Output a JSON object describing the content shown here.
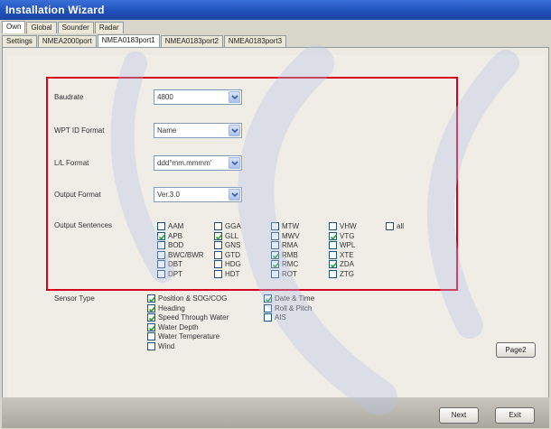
{
  "window": {
    "title": "Installation Wizard"
  },
  "tabs_top": [
    "Own",
    "Global",
    "Sounder",
    "Radar"
  ],
  "tabs_sub": [
    "Settings",
    "NMEA2000port",
    "NMEA0183port1",
    "NMEA0183port2",
    "NMEA0183port3"
  ],
  "active_sub_tab": "NMEA0183port1",
  "fields": {
    "baudrate": {
      "label": "Baudrate",
      "value": "4800"
    },
    "wpt_id": {
      "label": "WPT ID Format",
      "value": "Name"
    },
    "ll_format": {
      "label": "L/L Format",
      "value": "ddd°mm.mmmm'"
    },
    "output_format": {
      "label": "Output Format",
      "value": "Ver.3.0"
    }
  },
  "output_sentences_label": "Output Sentences",
  "output_sentences": [
    {
      "name": "AAM",
      "checked": false
    },
    {
      "name": "APB",
      "checked": true
    },
    {
      "name": "BOD",
      "checked": false
    },
    {
      "name": "BWC/BWR",
      "checked": false
    },
    {
      "name": "DBT",
      "checked": false
    },
    {
      "name": "DPT",
      "checked": false
    },
    {
      "name": "GGA",
      "checked": false
    },
    {
      "name": "GLL",
      "checked": true
    },
    {
      "name": "GNS",
      "checked": false
    },
    {
      "name": "GTD",
      "checked": false
    },
    {
      "name": "HDG",
      "checked": false
    },
    {
      "name": "HDT",
      "checked": false
    },
    {
      "name": "MTW",
      "checked": false
    },
    {
      "name": "MWV",
      "checked": false
    },
    {
      "name": "RMA",
      "checked": false
    },
    {
      "name": "RMB",
      "checked": true
    },
    {
      "name": "RMC",
      "checked": true
    },
    {
      "name": "ROT",
      "checked": false
    },
    {
      "name": "VHW",
      "checked": false
    },
    {
      "name": "VTG",
      "checked": true
    },
    {
      "name": "WPL",
      "checked": false
    },
    {
      "name": "XTE",
      "checked": false
    },
    {
      "name": "ZDA",
      "checked": true
    },
    {
      "name": "ZTG",
      "checked": false
    },
    {
      "name": "all",
      "checked": false
    }
  ],
  "sensor_type_label": "Sensor Type",
  "sensor_types": [
    {
      "name": "Position & SOG/COG",
      "checked": true
    },
    {
      "name": "Heading",
      "checked": true
    },
    {
      "name": "Speed Through Water",
      "checked": true
    },
    {
      "name": "Water Depth",
      "checked": true
    },
    {
      "name": "Water Temperature",
      "checked": false
    },
    {
      "name": "Wind",
      "checked": false
    },
    {
      "name": "Date & Time",
      "checked": true
    },
    {
      "name": "Roll & Pitch",
      "checked": false
    },
    {
      "name": "AIS",
      "checked": false
    }
  ],
  "buttons": {
    "page2": "Page2",
    "next": "Next",
    "exit": "Exit"
  },
  "colors": {
    "titlebar": "#1f4fb8",
    "highlight_box": "#d4001e",
    "check": "#21a121"
  }
}
